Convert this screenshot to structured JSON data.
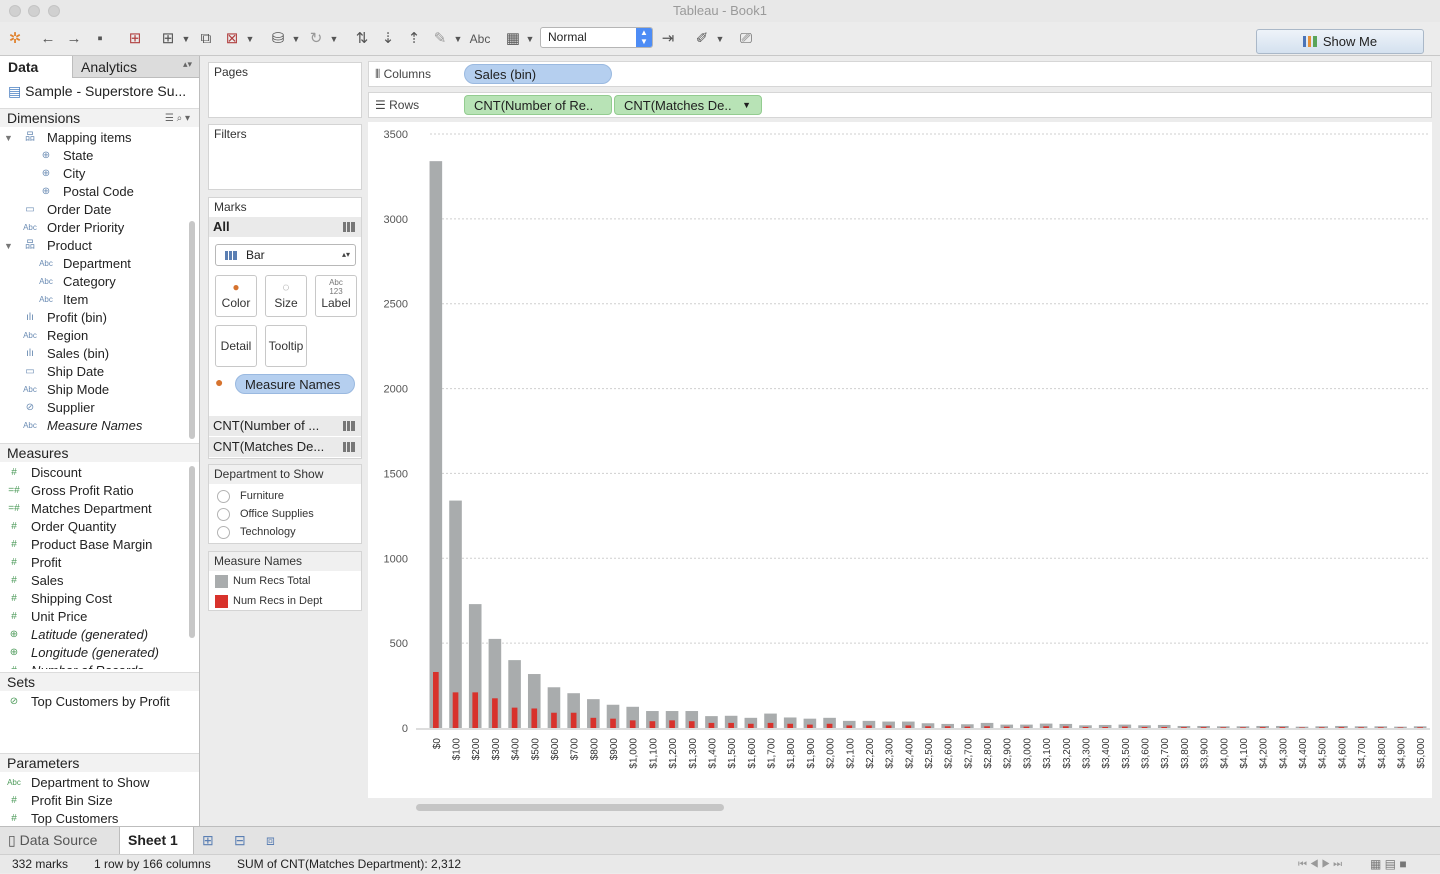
{
  "window": {
    "title": "Tableau - Book1"
  },
  "toolbar": {
    "mark_size_option": "Normal",
    "abc_label": "Abc",
    "show_me_label": "Show Me"
  },
  "left_pane": {
    "tabs": [
      "Data",
      "Analytics"
    ],
    "datasource": "Sample - Superstore Su...",
    "dimensions_header": "Dimensions",
    "dimensions": [
      {
        "label": "Mapping items",
        "icon": "hierarchy-icon",
        "level": 0,
        "expand": true
      },
      {
        "label": "State",
        "icon": "globe-icon",
        "level": 1
      },
      {
        "label": "City",
        "icon": "globe-icon",
        "level": 1
      },
      {
        "label": "Postal Code",
        "icon": "globe-icon",
        "level": 1
      },
      {
        "label": "Order Date",
        "icon": "calendar-icon",
        "level": 0
      },
      {
        "label": "Order Priority",
        "icon": "abc-icon",
        "level": 0
      },
      {
        "label": "Product",
        "icon": "hierarchy-icon",
        "level": 0,
        "expand": true
      },
      {
        "label": "Department",
        "icon": "abc-icon",
        "level": 1
      },
      {
        "label": "Category",
        "icon": "abc-icon",
        "level": 1
      },
      {
        "label": "Item",
        "icon": "abc-icon",
        "level": 1
      },
      {
        "label": "Profit (bin)",
        "icon": "bin-icon",
        "level": 0
      },
      {
        "label": "Region",
        "icon": "abc-icon",
        "level": 0
      },
      {
        "label": "Sales (bin)",
        "icon": "bin-icon",
        "level": 0
      },
      {
        "label": "Ship Date",
        "icon": "calendar-icon",
        "level": 0
      },
      {
        "label": "Ship Mode",
        "icon": "abc-icon",
        "level": 0
      },
      {
        "label": "Supplier",
        "icon": "paperclip-icon",
        "level": 0
      },
      {
        "label": "Measure Names",
        "icon": "abc-icon",
        "level": 0,
        "italic": true
      }
    ],
    "measures_header": "Measures",
    "measures": [
      {
        "label": "Discount",
        "icon": "number-icon"
      },
      {
        "label": "Gross Profit Ratio",
        "icon": "calc-number-icon"
      },
      {
        "label": "Matches Department",
        "icon": "calc-number-icon"
      },
      {
        "label": "Order Quantity",
        "icon": "number-icon"
      },
      {
        "label": "Product Base Margin",
        "icon": "number-icon"
      },
      {
        "label": "Profit",
        "icon": "number-icon"
      },
      {
        "label": "Sales",
        "icon": "number-icon"
      },
      {
        "label": "Shipping Cost",
        "icon": "number-icon"
      },
      {
        "label": "Unit Price",
        "icon": "number-icon"
      },
      {
        "label": "Latitude (generated)",
        "icon": "globe-icon",
        "italic": true
      },
      {
        "label": "Longitude (generated)",
        "icon": "globe-icon",
        "italic": true
      },
      {
        "label": "Number of Records",
        "icon": "number-icon",
        "italic": true
      }
    ],
    "sets_header": "Sets",
    "sets": [
      {
        "label": "Top Customers by Profit",
        "icon": "set-icon"
      }
    ],
    "parameters_header": "Parameters",
    "parameters": [
      {
        "label": "Department to Show",
        "icon": "abc-icon"
      },
      {
        "label": "Profit Bin Size",
        "icon": "number-icon"
      },
      {
        "label": "Top Customers",
        "icon": "number-icon"
      }
    ]
  },
  "cards": {
    "pages": "Pages",
    "filters": "Filters",
    "marks": {
      "header": "Marks",
      "all": "All",
      "type": "Bar",
      "buttons": [
        "Color",
        "Size",
        "Label",
        "Detail",
        "Tooltip"
      ],
      "label_glyph": "Abc\n123",
      "color_pill": "Measure Names",
      "measures": [
        "CNT(Number of ...",
        "CNT(Matches De..."
      ]
    },
    "param_control": {
      "title": "Department to Show",
      "options": [
        "Furniture",
        "Office Supplies",
        "Technology"
      ]
    },
    "color_legend": {
      "title": "Measure Names",
      "items": [
        {
          "label": "Num Recs Total",
          "color": "#a9acad"
        },
        {
          "label": "Num Recs in Dept",
          "color": "#d8322c"
        }
      ]
    }
  },
  "shelves": {
    "columns_label": "Columns",
    "columns_pills": [
      "Sales (bin)"
    ],
    "rows_label": "Rows",
    "rows_pills": [
      "CNT(Number of Re..",
      "CNT(Matches De.."
    ]
  },
  "chart_data": {
    "type": "bar",
    "categories": [
      "$0",
      "$100",
      "$200",
      "$300",
      "$400",
      "$500",
      "$600",
      "$700",
      "$800",
      "$900",
      "$1,000",
      "$1,100",
      "$1,200",
      "$1,300",
      "$1,400",
      "$1,500",
      "$1,600",
      "$1,700",
      "$1,800",
      "$1,900",
      "$2,000",
      "$2,100",
      "$2,200",
      "$2,300",
      "$2,400",
      "$2,500",
      "$2,600",
      "$2,700",
      "$2,800",
      "$2,900",
      "$3,000",
      "$3,100",
      "$3,200",
      "$3,300",
      "$3,400",
      "$3,500",
      "$3,600",
      "$3,700",
      "$3,800",
      "$3,900",
      "$4,000",
      "$4,100",
      "$4,200",
      "$4,300",
      "$4,400",
      "$4,500",
      "$4,600",
      "$4,700",
      "$4,800",
      "$4,900",
      "$5,000"
    ],
    "series": [
      {
        "name": "Num Recs Total",
        "color": "#a9acad",
        "values": [
          3340,
          1340,
          730,
          525,
          400,
          318,
          240,
          205,
          170,
          137,
          125,
          100,
          100,
          100,
          70,
          72,
          60,
          85,
          62,
          55,
          60,
          42,
          42,
          38,
          38,
          28,
          24,
          22,
          30,
          20,
          20,
          26,
          24,
          16,
          18,
          20,
          16,
          18,
          12,
          12,
          10,
          10,
          12,
          12,
          8,
          10,
          12,
          10,
          10,
          8,
          10
        ]
      },
      {
        "name": "Num Recs in Dept",
        "color": "#d8322c",
        "values": [
          330,
          210,
          210,
          175,
          120,
          115,
          90,
          90,
          60,
          55,
          45,
          40,
          45,
          40,
          30,
          30,
          25,
          30,
          25,
          20,
          25,
          15,
          15,
          15,
          15,
          10,
          10,
          8,
          10,
          8,
          8,
          10,
          10,
          6,
          6,
          8,
          6,
          6,
          5,
          5,
          4,
          4,
          5,
          5,
          3,
          4,
          5,
          4,
          4,
          3,
          4
        ]
      }
    ],
    "ylim": [
      0,
      3500
    ],
    "yticks": [
      0,
      500,
      1000,
      1500,
      2000,
      2500,
      3000,
      3500
    ],
    "ytick_labels": [
      "0",
      "500",
      "1000",
      "1500",
      "2000",
      "2500",
      "3000",
      "3500"
    ],
    "grid": true,
    "xlabel": "",
    "ylabel": "",
    "title": ""
  },
  "sheet_tabs": {
    "datasource_tab": "Data Source",
    "sheet_tab": "Sheet 1"
  },
  "status": {
    "marks": "332 marks",
    "dims": "1 row by 166 columns",
    "sum": "SUM of CNT(Matches Department): 2,312"
  }
}
